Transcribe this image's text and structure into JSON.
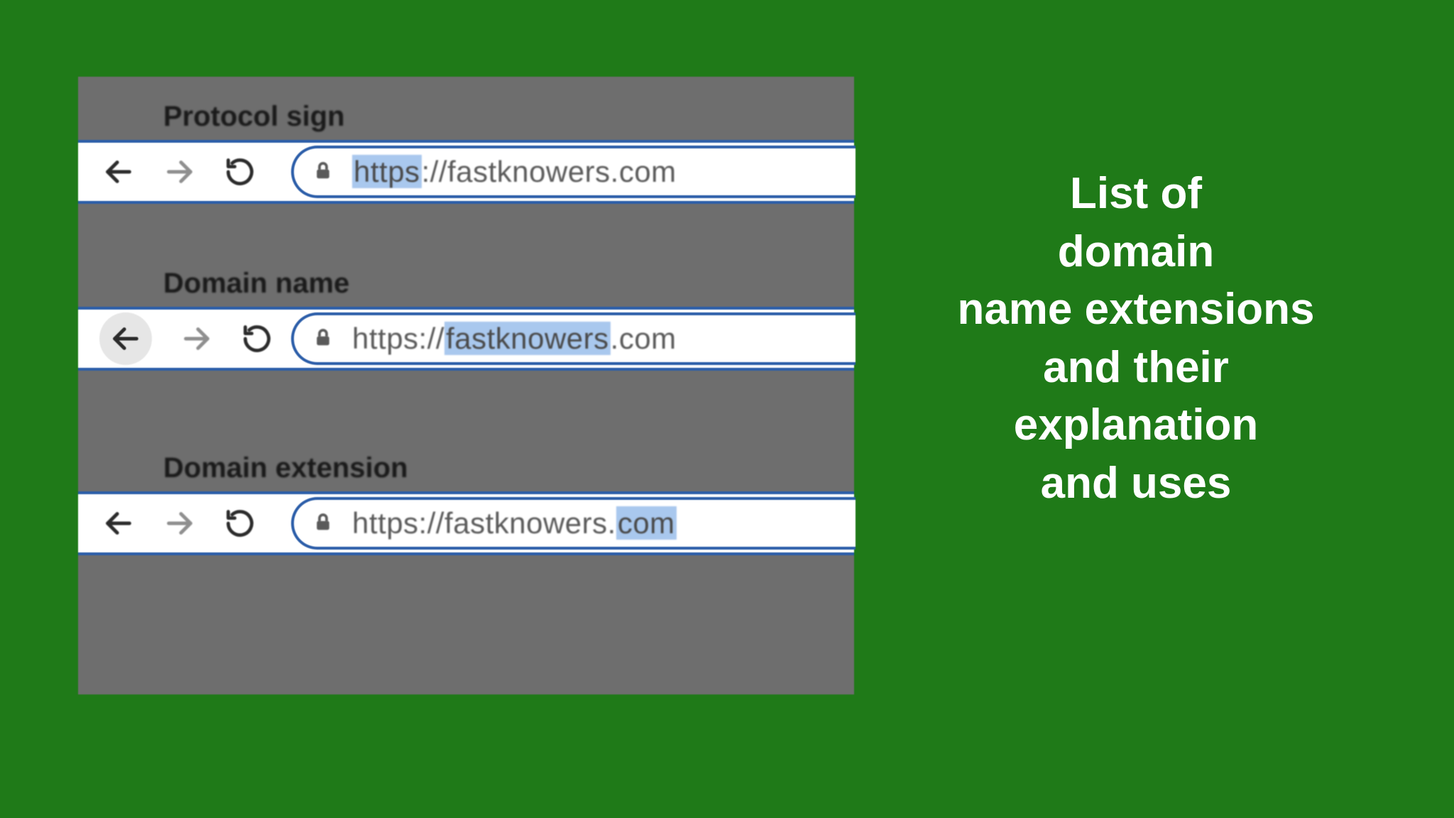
{
  "title_lines": {
    "l1": "List of",
    "l2": "domain",
    "l3": "name extensions",
    "l4": "and their",
    "l5": "explanation",
    "l6": "and uses"
  },
  "examples": [
    {
      "label": "Protocol sign",
      "url_before": "",
      "url_highlight": "https",
      "url_after": "://fastknowers.com",
      "back_circle": false
    },
    {
      "label": "Domain name",
      "url_before": "https://",
      "url_highlight": "fastknowers",
      "url_after": ".com",
      "back_circle": true
    },
    {
      "label": "Domain extension",
      "url_before": "https://fastknowers.",
      "url_highlight": "com",
      "url_after": "",
      "back_circle": false
    }
  ]
}
